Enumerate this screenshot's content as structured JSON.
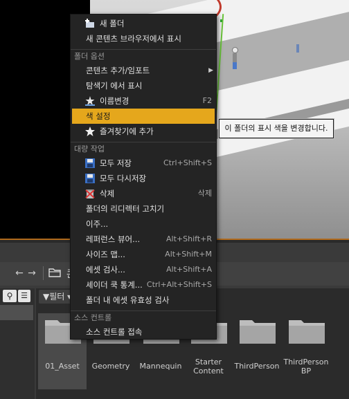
{
  "nav": {
    "back_icon": "arrow-left-icon",
    "forward_icon": "arrow-right-icon",
    "path_partial": "콘"
  },
  "filter": {
    "label": "필터"
  },
  "folders": [
    {
      "label": "01_Asset",
      "selected": true
    },
    {
      "label": "Geometry",
      "selected": false
    },
    {
      "label": "Mannequin",
      "selected": false
    },
    {
      "label": "Starter Content",
      "selected": false
    },
    {
      "label": "ThirdPerson",
      "selected": false
    },
    {
      "label": "ThirdPerson BP",
      "selected": false
    }
  ],
  "menu": {
    "items": [
      {
        "id": "new-folder",
        "label": "새 폴더",
        "icon": "new-folder-icon"
      },
      {
        "id": "show-in-content-browser",
        "label": "새 콘텐츠 브라우저에서 표시"
      }
    ],
    "section_folder": "폴더 옵션",
    "folder_items": [
      {
        "id": "add-import",
        "label": "콘텐츠 추가/임포트",
        "submenu": true
      },
      {
        "id": "show-in-explorer",
        "label": "탐색기 에서 표시"
      },
      {
        "id": "rename",
        "label": "이름변경",
        "shortcut": "F2",
        "icon": "rename-icon"
      },
      {
        "id": "set-color",
        "label": "색 설정",
        "highlight": true
      },
      {
        "id": "add-favorite",
        "label": "즐겨찾기에 추가",
        "icon": "star-icon"
      }
    ],
    "section_bulk": "대량 작업",
    "bulk_items": [
      {
        "id": "save-all",
        "label": "모두 저장",
        "shortcut": "Ctrl+Shift+S",
        "icon": "save-icon"
      },
      {
        "id": "resave-all",
        "label": "모두 다시저장",
        "icon": "save-icon"
      },
      {
        "id": "delete",
        "label": "삭제",
        "shortcut": "삭제",
        "icon": "delete-icon"
      },
      {
        "id": "fix-redirectors",
        "label": "폴더의 리디렉터 고치기"
      },
      {
        "id": "migrate",
        "label": "이주..."
      },
      {
        "id": "reference-viewer",
        "label": "레퍼런스 뷰어...",
        "shortcut": "Alt+Shift+R"
      },
      {
        "id": "size-map",
        "label": "사이즈 맵...",
        "shortcut": "Alt+Shift+M"
      },
      {
        "id": "audit-assets",
        "label": "에셋 검사...",
        "shortcut": "Alt+Shift+A"
      },
      {
        "id": "shader-cook-stats",
        "label": "셰이더 쿡 통계...",
        "shortcut": "Ctrl+Alt+Shift+S"
      },
      {
        "id": "validate-assets",
        "label": "폴더 내 에셋 유효성 검사"
      }
    ],
    "section_source": "소스 컨트롤",
    "source_items": [
      {
        "id": "connect-source-control",
        "label": "소스 컨트롤 접속"
      }
    ]
  },
  "tooltip": {
    "text": "이 폴더의 표시 색을 변경합니다."
  },
  "colors": {
    "highlight": "#e5a71c",
    "menu_bg": "#242424",
    "accent_orange": "#b06a1c"
  }
}
